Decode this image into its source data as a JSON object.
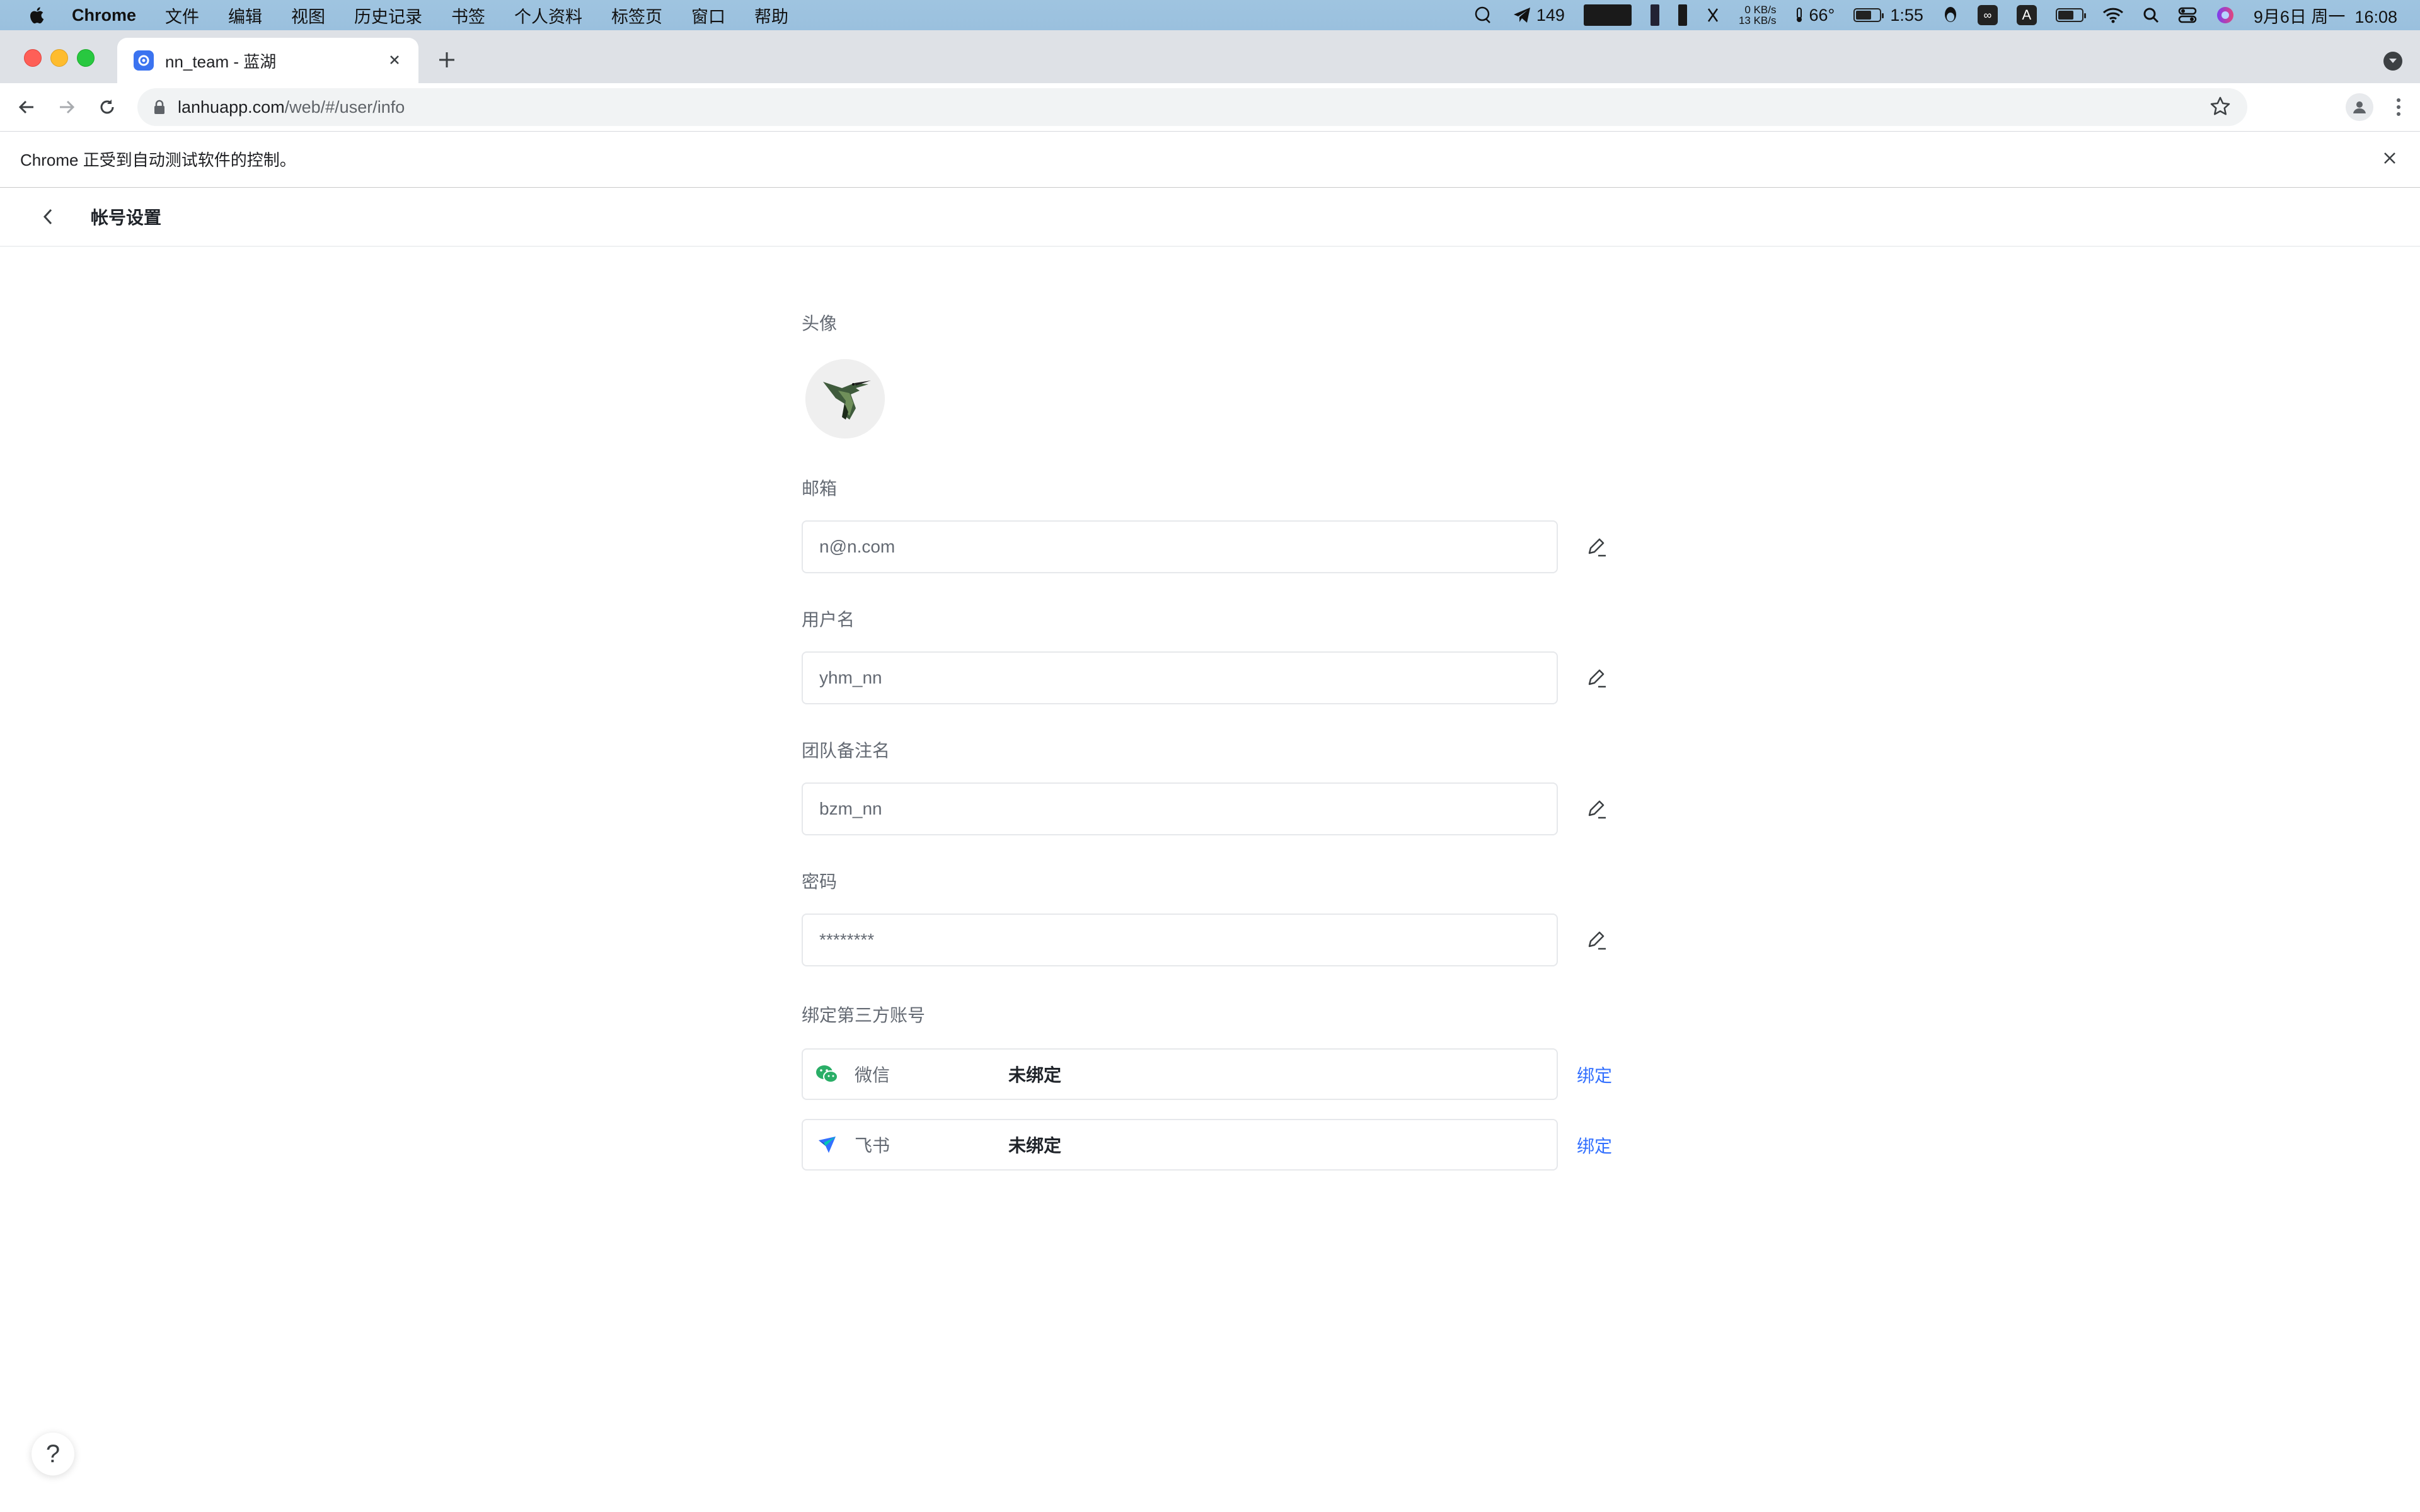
{
  "menubar": {
    "app_name": "Chrome",
    "menus": [
      "文件",
      "编辑",
      "视图",
      "历史记录",
      "书签",
      "个人资料",
      "标签页",
      "窗口",
      "帮助"
    ],
    "telegram_count": "149",
    "net_up": "0 KB/s",
    "net_down": "13 KB/s",
    "temperature": "66°",
    "battery_time": "1:55",
    "input_source": "A",
    "datetime": "9月6日 周一  16:08"
  },
  "browser": {
    "tab_title": "nn_team - 蓝湖",
    "url_host": "lanhuapp.com",
    "url_path": "/web/#/user/info",
    "automation_notice": "Chrome 正受到自动测试软件的控制。"
  },
  "page": {
    "title": "帐号设置",
    "avatar_label": "头像",
    "email": {
      "label": "邮箱",
      "value": "n@n.com"
    },
    "username": {
      "label": "用户名",
      "value": "yhm_nn"
    },
    "team_alias": {
      "label": "团队备注名",
      "value": "bzm_nn"
    },
    "password": {
      "label": "密码",
      "value": "********"
    },
    "third_party": {
      "label": "绑定第三方账号",
      "accounts": [
        {
          "name": "微信",
          "status": "未绑定",
          "action": "绑定",
          "icon": "wechat-icon",
          "color": "#2aae67"
        },
        {
          "name": "飞书",
          "status": "未绑定",
          "action": "绑定",
          "icon": "feishu-icon",
          "color": "#3370ff"
        }
      ]
    },
    "help": "?"
  },
  "colors": {
    "accent": "#3370ff",
    "label": "#646a73",
    "border": "#e6e8eb"
  }
}
